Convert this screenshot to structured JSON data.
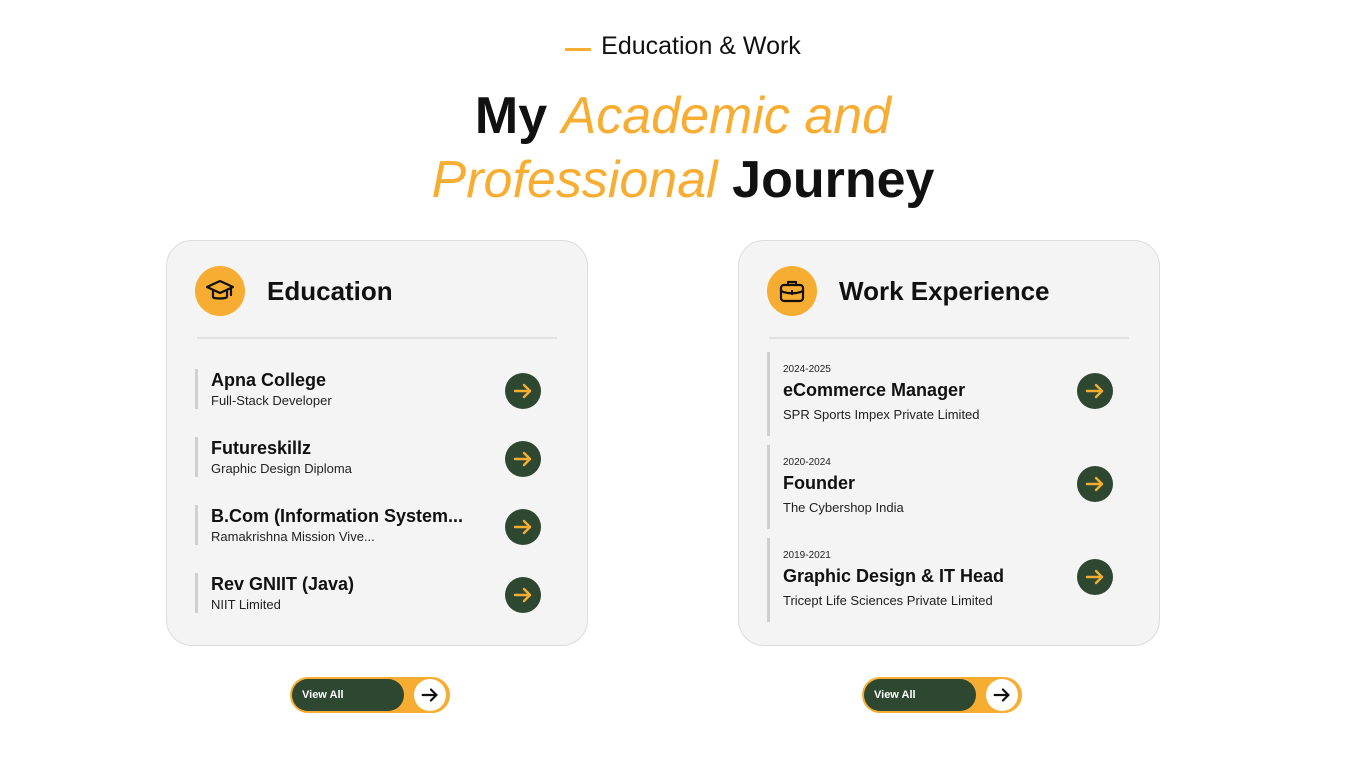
{
  "eyebrow": "Education & Work",
  "headline": {
    "line1_plain": "My",
    "line1_accent": "Academic and",
    "line2_accent": "Professional",
    "line2_plain": "Journey"
  },
  "colors": {
    "accent": "#f7ad31",
    "dark_green": "#2e4731",
    "card_bg": "#f4f4f4"
  },
  "education": {
    "title": "Education",
    "icon": "graduation-cap-icon",
    "items": [
      {
        "title": "Apna College",
        "subtitle": "Full-Stack Developer"
      },
      {
        "title": "Futureskillz",
        "subtitle": "Graphic Design Diploma"
      },
      {
        "title": "B.Com (Information System...",
        "subtitle": "Ramakrishna Mission Vive..."
      },
      {
        "title": "Rev GNIIT (Java)",
        "subtitle": "NIIT Limited"
      }
    ],
    "view_all": "View All"
  },
  "work": {
    "title": "Work Experience",
    "icon": "briefcase-icon",
    "items": [
      {
        "date": "2024-2025",
        "title": "eCommerce Manager",
        "subtitle": "SPR Sports Impex Private Limited"
      },
      {
        "date": "2020-2024",
        "title": "Founder",
        "subtitle": "The Cybershop India"
      },
      {
        "date": "2019-2021",
        "title": "Graphic Design & IT Head",
        "subtitle": "Tricept Life Sciences Private Limited"
      }
    ],
    "view_all": "View All"
  }
}
